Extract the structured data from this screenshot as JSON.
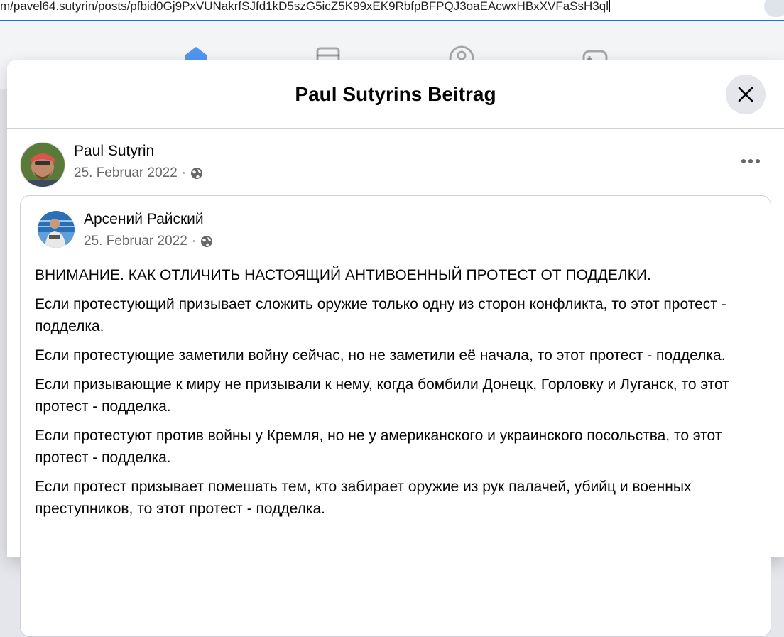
{
  "browser": {
    "url": "m/pavel64.sutyrin/posts/pfbid0Gj9PxVUNakrfSJfd1kD5szG5icZ5K99xEK9RbfpBFPQJ3oaEAcwxHBxXVFaSsH3ql"
  },
  "nav": {
    "icons": [
      "home-icon",
      "marketplace-icon",
      "groups-icon",
      "gaming-icon"
    ]
  },
  "modal": {
    "title": "Paul Sutyrins Beitrag",
    "close_icon": "close-icon"
  },
  "post": {
    "author": "Paul Sutyrin",
    "date": "25. Februar 2022",
    "separator": "·",
    "privacy_icon": "globe-icon",
    "more_icon": "more-horizontal-icon"
  },
  "shared_post": {
    "author": "Арсений Райский",
    "date": "25. Februar 2022",
    "separator": "·",
    "privacy_icon": "globe-icon",
    "paragraphs": [
      "ВНИМАНИЕ. КАК ОТЛИЧИТЬ НАСТОЯЩИЙ АНТИВОЕННЫЙ ПРОТЕСТ ОТ ПОДДЕЛКИ.",
      "Если протестующий призывает сложить оружие только одну из сторон конфликта, то этот протест - подделка.",
      "Если протестующие заметили войну сейчас, но не заметили её начала, то этот протест - подделка.",
      "Если призывающие к миру не призывали к нему, когда бомбили Донецк, Горловку и Луганск, то этот протест - подделка.",
      "Если протестуют против войны у Кремля, но не у американского и украинского посольства, то этот протест - подделка.",
      "Если протест призывает помешать тем, кто забирает оружие из рук палачей, убийц и военных преступников, то этот протест - подделка."
    ]
  },
  "colors": {
    "accent": "#1877f2",
    "secondary_text": "#65676b",
    "border": "#ced0d4"
  }
}
